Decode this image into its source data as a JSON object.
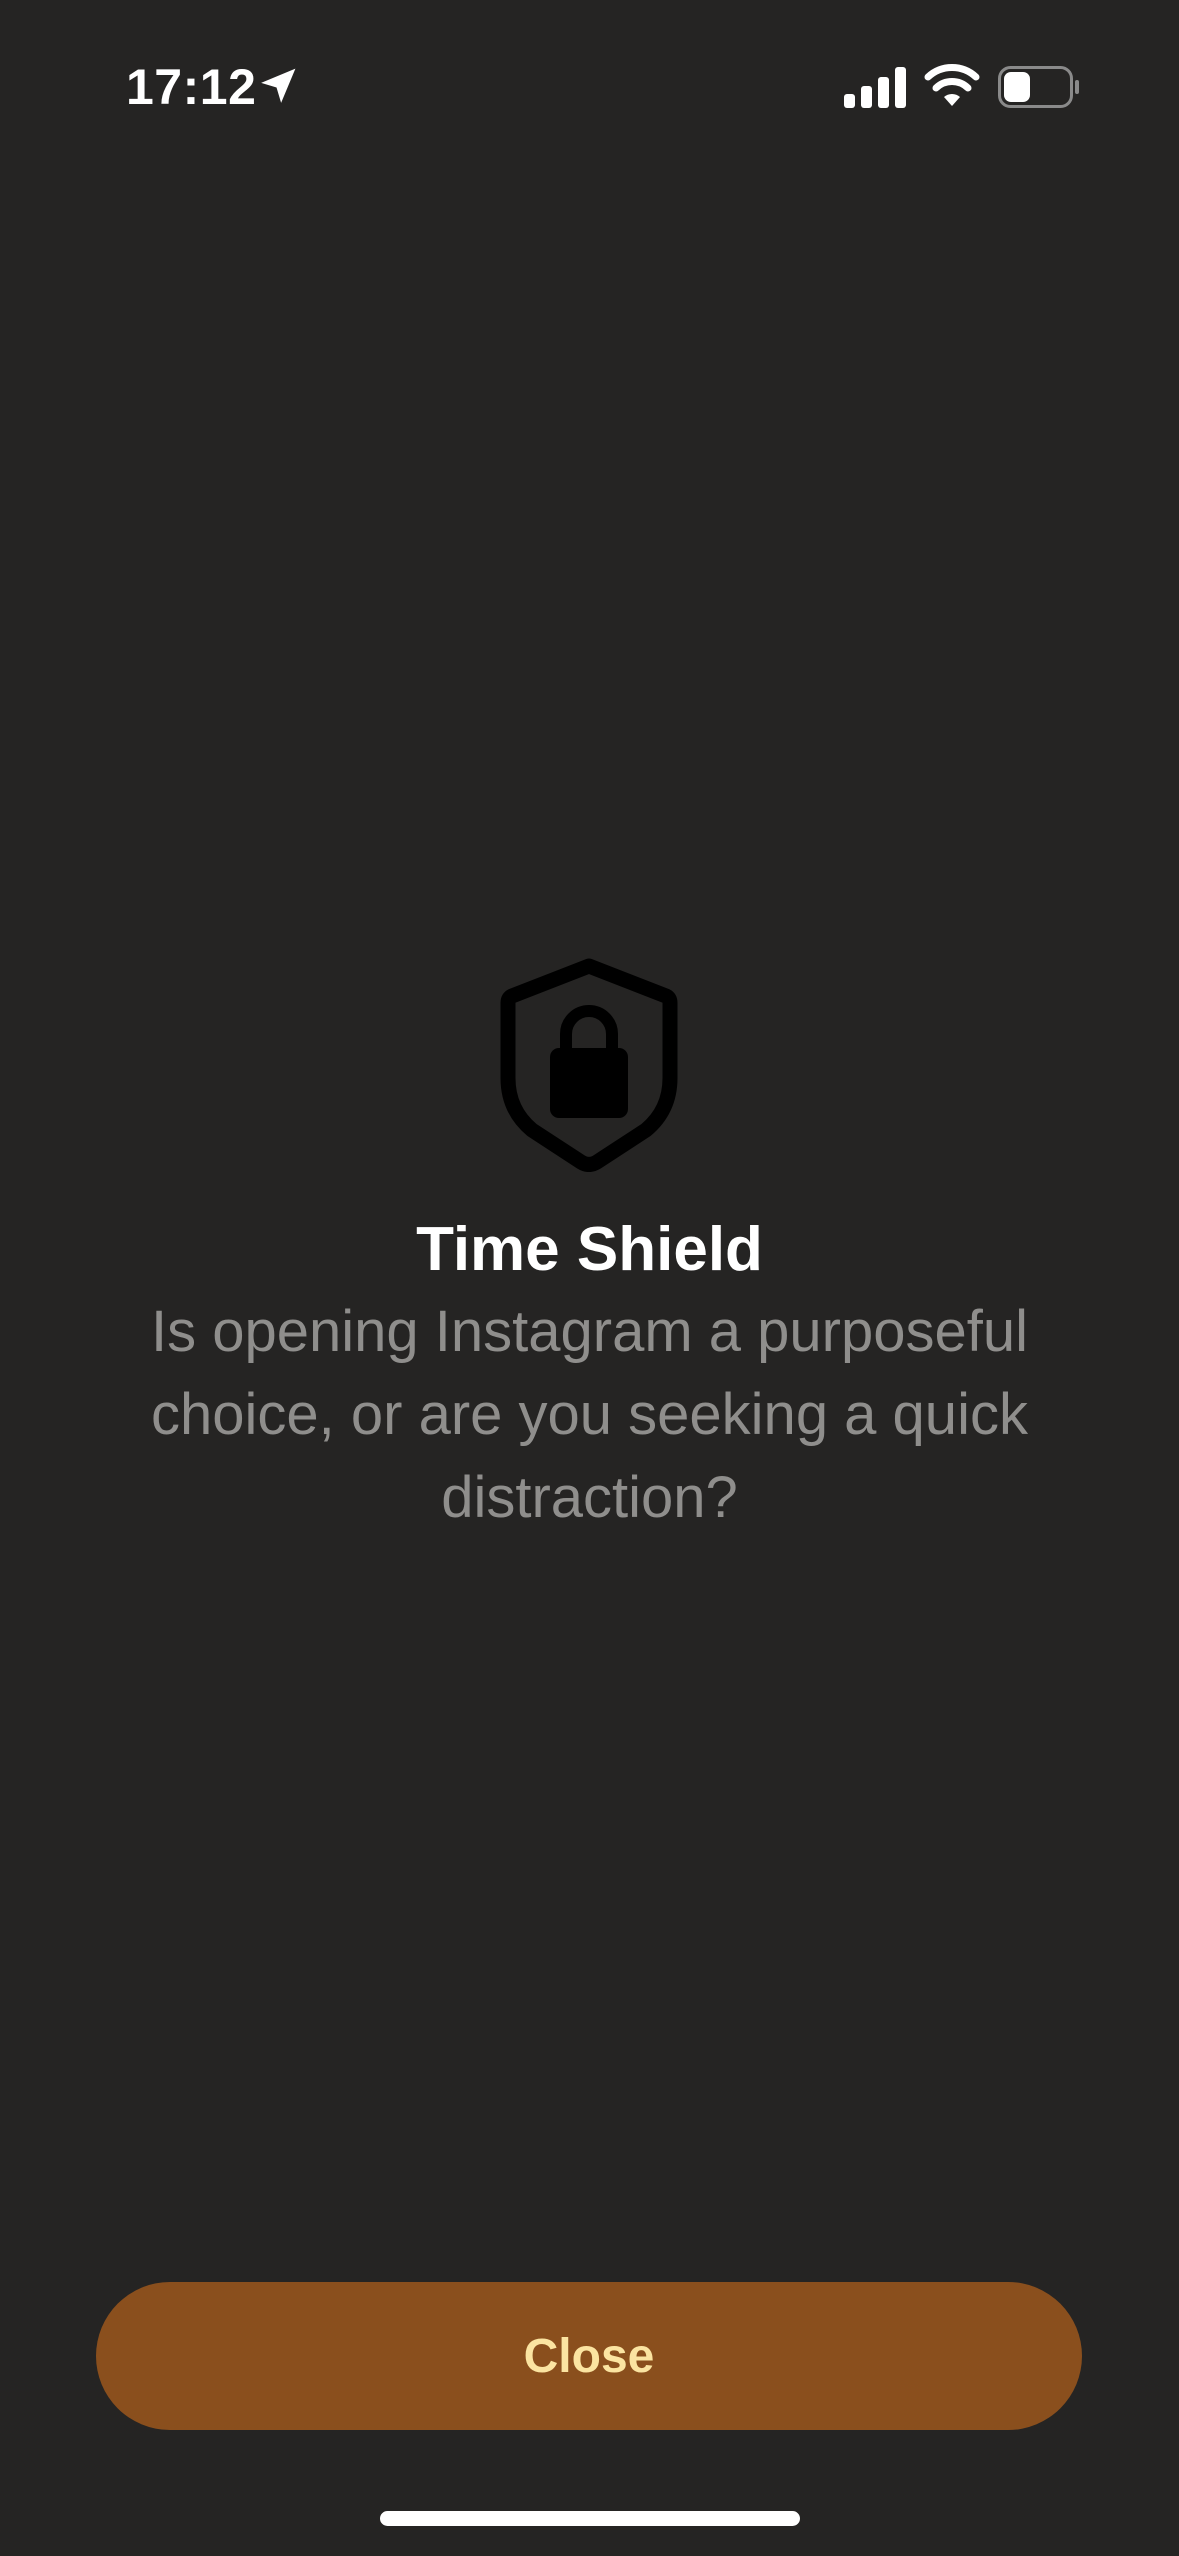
{
  "status_bar": {
    "time": "17:12",
    "icons": [
      "location-arrow-icon",
      "cellular-signal-icon",
      "wifi-icon",
      "battery-low-icon"
    ]
  },
  "shield": {
    "title": "Time Shield",
    "message": "Is opening Instagram a purposeful choice, or are you seeking a quick distraction?",
    "icon": "shield-lock-icon"
  },
  "actions": {
    "close_label": "Close"
  },
  "colors": {
    "background": "#252423",
    "title": "#ffffff",
    "message": "#8f8e8c",
    "button_background": "#8a4f1d",
    "button_text": "#fbe4a1",
    "shield_icon": "#000000"
  }
}
